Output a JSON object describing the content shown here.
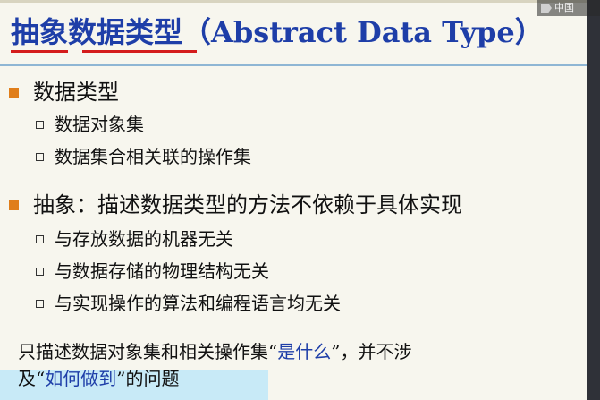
{
  "title": {
    "cn": "抽象数据类型",
    "en": "（Abstract Data Type）"
  },
  "watermark": {
    "text": "中国"
  },
  "sections": [
    {
      "label": "数据类型",
      "items": [
        "数据对象集",
        "数据集合相关联的操作集"
      ]
    },
    {
      "label": "抽象：描述数据类型的方法不依赖于具体实现",
      "items": [
        "与存放数据的机器无关",
        "与数据存储的物理结构无关",
        "与实现操作的算法和编程语言均无关"
      ]
    }
  ],
  "summary": {
    "line1_a": "只描述数据对象集和相关操作集“",
    "line1_hl": "是什么",
    "line1_b": "”，并不涉",
    "line2_a": "及“",
    "line2_hl": "如何做到",
    "line2_b": "”的问题"
  },
  "colors": {
    "title": "#1e3ea8",
    "underline": "#d41c1c",
    "bullet": "#e07e1a",
    "highlight": "#1e3ea8",
    "band": "#c8eaf7"
  }
}
